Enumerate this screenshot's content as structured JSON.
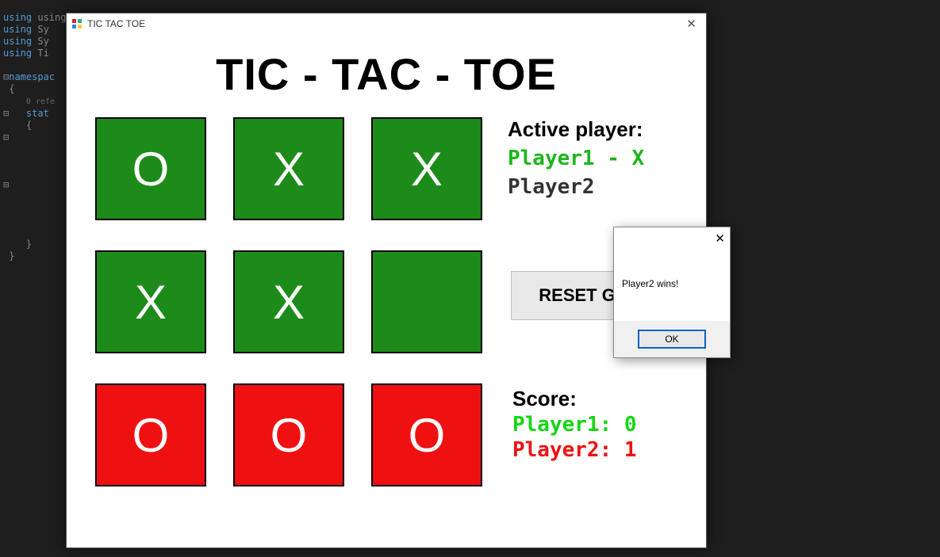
{
  "code": {
    "l1": "using System.Linq;",
    "l2": "using Sy",
    "l3": "using Sy",
    "l4": "using Ti",
    "l5": "namespac",
    "l6": "{",
    "l7": "    0 refe",
    "l8": "    stat",
    "l9": "    {",
    "l10": "    }",
    "l11": "}"
  },
  "window": {
    "title": "TIC TAC TOE",
    "close_glyph": "✕",
    "heading": "TIC - TAC - TOE"
  },
  "board": {
    "cells": [
      {
        "mark": "O",
        "color": "green"
      },
      {
        "mark": "X",
        "color": "green"
      },
      {
        "mark": "X",
        "color": "green"
      },
      {
        "mark": "X",
        "color": "green"
      },
      {
        "mark": "X",
        "color": "green"
      },
      {
        "mark": "",
        "color": "green"
      },
      {
        "mark": "O",
        "color": "red"
      },
      {
        "mark": "O",
        "color": "red"
      },
      {
        "mark": "O",
        "color": "red"
      }
    ]
  },
  "side": {
    "active_label": "Active player:",
    "player1": "Player1 - X",
    "player2": "Player2",
    "reset_label": "RESET GAME",
    "score_label": "Score:",
    "score_p1": "Player1:  0",
    "score_p2": "Player2:  1"
  },
  "msgbox": {
    "close_glyph": "✕",
    "text": "Player2 wins!",
    "ok_label": "OK"
  }
}
